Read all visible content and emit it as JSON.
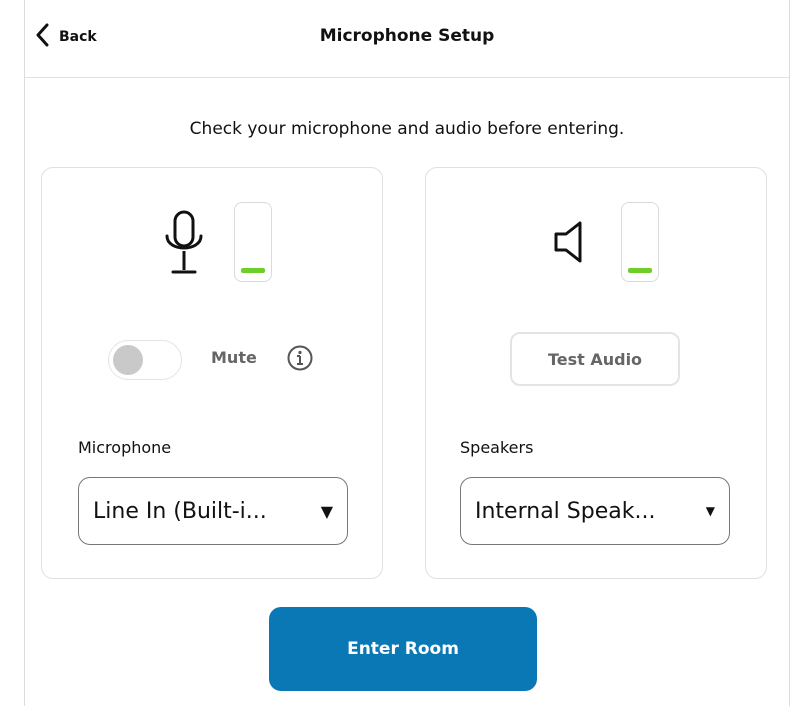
{
  "header": {
    "back_label": "Back",
    "title": "Microphone Setup"
  },
  "subtitle": "Check your microphone and audio before entering.",
  "microphone_panel": {
    "mic_icon": "microphone-icon",
    "level_meter": 0.1,
    "mute_toggle_on": false,
    "mute_label": "Mute",
    "info_icon": "info-circle-icon",
    "field_label": "Microphone",
    "selected_device": "Line In (Built-i...",
    "caret_icon": "caret-down-icon"
  },
  "speaker_panel": {
    "speaker_icon": "speaker-icon",
    "level_meter": 0.1,
    "test_button_label": "Test Audio",
    "field_label": "Speakers",
    "selected_device": "Internal Speak...",
    "caret_icon": "caret-down-icon"
  },
  "enter_button_label": "Enter Room",
  "colors": {
    "primary": "#0b78b6",
    "meter_level": "#6fcf2a",
    "toggle_knob": "#c9c9c9"
  }
}
